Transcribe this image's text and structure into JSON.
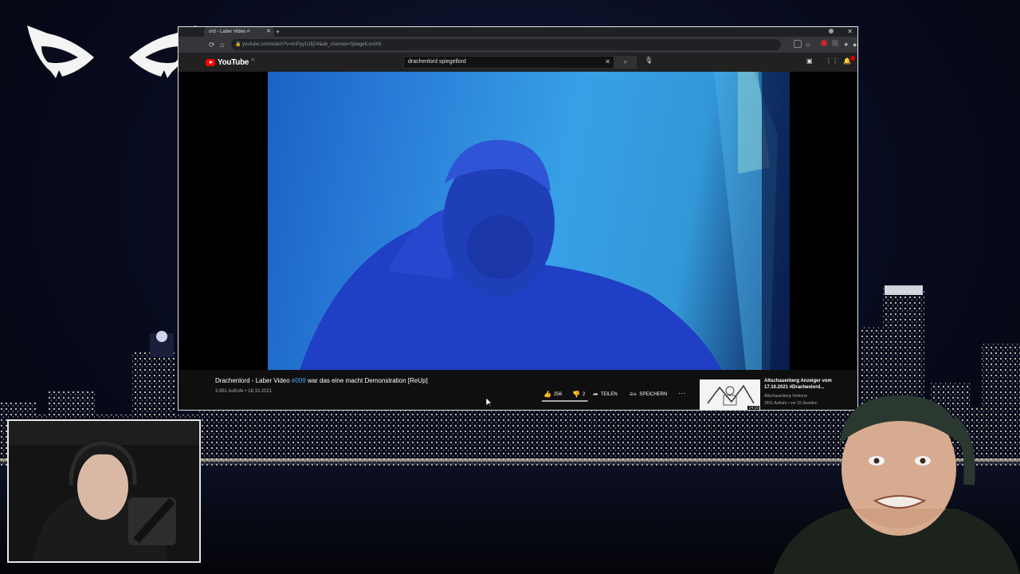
{
  "browser": {
    "tab_title": "ord - Laber Video #",
    "url": "youtube.com/watch?v=knPyy1UfjO4&ab_channel=SpiegelLordXII",
    "new_tab_icon": "plus-icon"
  },
  "youtube": {
    "logo_text": "YouTube",
    "logo_country": "AT",
    "search_query": "drachenlord spiegellord"
  },
  "video": {
    "title_prefix": "Drachenlord - Laber Video ",
    "title_tag": "#009",
    "title_suffix": " war das eine macht Demonstration [ReUp]",
    "meta": "3.981 Aufrufe • 18.10.2021",
    "likes": "256",
    "dislikes": "2",
    "share_label": "TEILEN",
    "save_label": "SPEICHERN",
    "like_ratio": 0.99
  },
  "recommendation": {
    "title": "Altschauerberg Anzeiger vom 17.10.2021 #Drachenlord...",
    "channel": "Altschauerberg Verborer",
    "meta": "2931 Aufrufe • vor 15 Stunden",
    "duration": "14:16"
  },
  "colors": {
    "yt_red": "#ff0000",
    "link_blue": "#3ea6ff",
    "video_blue": "#2a7ed8"
  }
}
